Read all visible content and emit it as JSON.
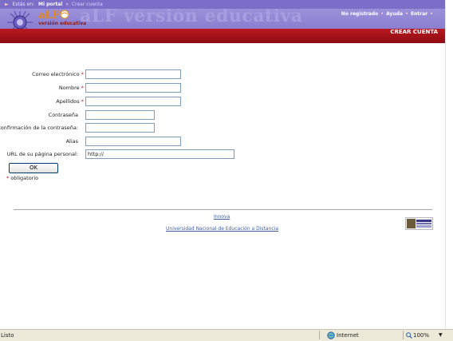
{
  "breadcrumb": {
    "prefix": "Estás en:",
    "home": "Mi portal",
    "current": "Crear cuenta"
  },
  "header": {
    "logo_name": "aLF",
    "logo_sub": "versión educativa",
    "watermark": "aLF versión educativa",
    "user_status": "No registrado",
    "help": "Ayuda",
    "login": "Entrar",
    "page_title": "CREAR CUENTA"
  },
  "form": {
    "email_label": "Correo electrónico",
    "name_label": "Nombre",
    "surname_label": "Apellidos",
    "password_label": "Contraseña",
    "confirm_label": "Confirmación de la contraseña:",
    "alias_label": "Alias",
    "url_label": "URL de su página personal:",
    "url_value": "http://",
    "required_marker": "*",
    "ok_label": "OK",
    "mandatory_note": "obligatorio"
  },
  "footer": {
    "link1": "Innova",
    "link2": "Universidad Nacional de Educación a Distancia"
  },
  "statusbar": {
    "status": "Listo",
    "zone": "Internet",
    "zoom": "100%"
  },
  "colors": {
    "header_purple": "#8a7fd0",
    "red_bar": "#a8131a",
    "required_red": "#c8141c"
  }
}
